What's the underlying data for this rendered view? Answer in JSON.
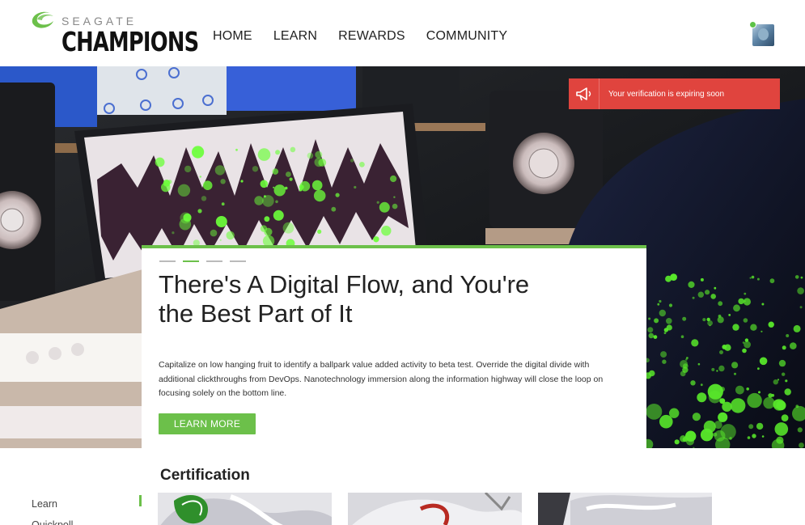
{
  "brand": {
    "top": "SEAGATE",
    "name": "CHAMPIONS"
  },
  "nav": [
    "HOME",
    "LEARN",
    "REWARDS",
    "COMMUNITY"
  ],
  "alert": {
    "text": "Your verification is expiring soon"
  },
  "hero": {
    "title": "There's A Digital Flow, and You're the Best Part of It",
    "body": "Capitalize on low hanging fruit to identify a ballpark value added activity to beta test. Override the digital divide with additional clickthroughs from DevOps. Nanotechnology immersion along the information highway will close the loop on focusing solely on the bottom line.",
    "button": "LEARN MORE",
    "slides": 4,
    "active_slide": 2
  },
  "section": {
    "heading": "Certification"
  },
  "side_nav": [
    "Learn",
    "Quickpoll"
  ],
  "colors": {
    "accent": "#6cc04a",
    "alert": "#e0443e",
    "text": "#222222"
  }
}
